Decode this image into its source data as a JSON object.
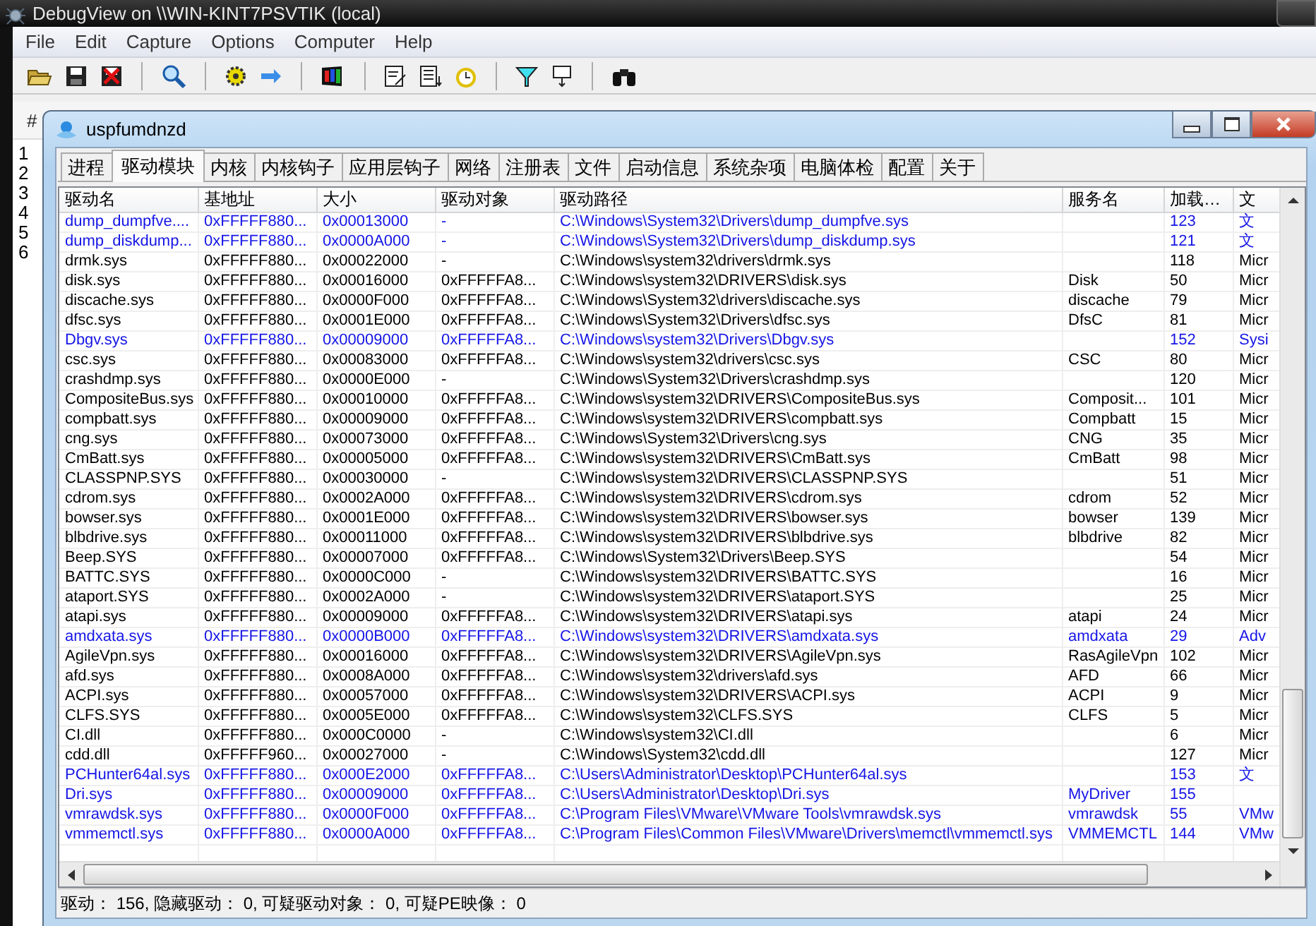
{
  "background_window": {
    "title": "DebugView on \\\\WIN-KINT7PSVTIK (local)",
    "menu": [
      "File",
      "Edit",
      "Capture",
      "Options",
      "Computer",
      "Help"
    ],
    "list": {
      "columns": [
        "#"
      ],
      "rows": [
        "1",
        "2",
        "3",
        "4",
        "5",
        "6"
      ]
    }
  },
  "window": {
    "title": "uspfumdnzd"
  },
  "tabs": [
    {
      "label": "进程",
      "selected": false
    },
    {
      "label": "驱动模块",
      "selected": true
    },
    {
      "label": "内核",
      "selected": false
    },
    {
      "label": "内核钩子",
      "selected": false
    },
    {
      "label": "应用层钩子",
      "selected": false
    },
    {
      "label": "网络",
      "selected": false
    },
    {
      "label": "注册表",
      "selected": false
    },
    {
      "label": "文件",
      "selected": false
    },
    {
      "label": "启动信息",
      "selected": false
    },
    {
      "label": "系统杂项",
      "selected": false
    },
    {
      "label": "电脑体检",
      "selected": false
    },
    {
      "label": "配置",
      "selected": false
    },
    {
      "label": "关于",
      "selected": false
    }
  ],
  "table": {
    "columns": [
      "驱动名",
      "基地址",
      "大小",
      "驱动对象",
      "驱动路径",
      "服务名",
      "加载…",
      "文"
    ],
    "rows": [
      {
        "highlighted": true,
        "cells": [
          "dump_dumpfve....",
          "0xFFFFF880...",
          "0x00013000",
          "-",
          "C:\\Windows\\System32\\Drivers\\dump_dumpfve.sys",
          "",
          "123",
          "文"
        ]
      },
      {
        "highlighted": true,
        "cells": [
          "dump_diskdump...",
          "0xFFFFF880...",
          "0x0000A000",
          "-",
          "C:\\Windows\\System32\\Drivers\\dump_diskdump.sys",
          "",
          "121",
          "文"
        ]
      },
      {
        "highlighted": false,
        "cells": [
          "drmk.sys",
          "0xFFFFF880...",
          "0x00022000",
          "-",
          "C:\\Windows\\system32\\drivers\\drmk.sys",
          "",
          "118",
          "Micr"
        ]
      },
      {
        "highlighted": false,
        "cells": [
          "disk.sys",
          "0xFFFFF880...",
          "0x00016000",
          "0xFFFFFA8...",
          "C:\\Windows\\system32\\DRIVERS\\disk.sys",
          "Disk",
          "50",
          "Micr"
        ]
      },
      {
        "highlighted": false,
        "cells": [
          "discache.sys",
          "0xFFFFF880...",
          "0x0000F000",
          "0xFFFFFA8...",
          "C:\\Windows\\System32\\drivers\\discache.sys",
          "discache",
          "79",
          "Micr"
        ]
      },
      {
        "highlighted": false,
        "cells": [
          "dfsc.sys",
          "0xFFFFF880...",
          "0x0001E000",
          "0xFFFFFA8...",
          "C:\\Windows\\System32\\Drivers\\dfsc.sys",
          "DfsC",
          "81",
          "Micr"
        ]
      },
      {
        "highlighted": true,
        "cells": [
          "Dbgv.sys",
          "0xFFFFF880...",
          "0x00009000",
          "0xFFFFFA8...",
          "C:\\Windows\\system32\\Drivers\\Dbgv.sys",
          "",
          "152",
          "Sysi"
        ]
      },
      {
        "highlighted": false,
        "cells": [
          "csc.sys",
          "0xFFFFF880...",
          "0x00083000",
          "0xFFFFFA8...",
          "C:\\Windows\\system32\\drivers\\csc.sys",
          "CSC",
          "80",
          "Micr"
        ]
      },
      {
        "highlighted": false,
        "cells": [
          "crashdmp.sys",
          "0xFFFFF880...",
          "0x0000E000",
          "-",
          "C:\\Windows\\System32\\Drivers\\crashdmp.sys",
          "",
          "120",
          "Micr"
        ]
      },
      {
        "highlighted": false,
        "cells": [
          "CompositeBus.sys",
          "0xFFFFF880...",
          "0x00010000",
          "0xFFFFFA8...",
          "C:\\Windows\\system32\\DRIVERS\\CompositeBus.sys",
          "Composit...",
          "101",
          "Micr"
        ]
      },
      {
        "highlighted": false,
        "cells": [
          "compbatt.sys",
          "0xFFFFF880...",
          "0x00009000",
          "0xFFFFFA8...",
          "C:\\Windows\\system32\\DRIVERS\\compbatt.sys",
          "Compbatt",
          "15",
          "Micr"
        ]
      },
      {
        "highlighted": false,
        "cells": [
          "cng.sys",
          "0xFFFFF880...",
          "0x00073000",
          "0xFFFFFA8...",
          "C:\\Windows\\System32\\Drivers\\cng.sys",
          "CNG",
          "35",
          "Micr"
        ]
      },
      {
        "highlighted": false,
        "cells": [
          "CmBatt.sys",
          "0xFFFFF880...",
          "0x00005000",
          "0xFFFFFA8...",
          "C:\\Windows\\system32\\DRIVERS\\CmBatt.sys",
          "CmBatt",
          "98",
          "Micr"
        ]
      },
      {
        "highlighted": false,
        "cells": [
          "CLASSPNP.SYS",
          "0xFFFFF880...",
          "0x00030000",
          "-",
          "C:\\Windows\\system32\\DRIVERS\\CLASSPNP.SYS",
          "",
          "51",
          "Micr"
        ]
      },
      {
        "highlighted": false,
        "cells": [
          "cdrom.sys",
          "0xFFFFF880...",
          "0x0002A000",
          "0xFFFFFA8...",
          "C:\\Windows\\system32\\DRIVERS\\cdrom.sys",
          "cdrom",
          "52",
          "Micr"
        ]
      },
      {
        "highlighted": false,
        "cells": [
          "bowser.sys",
          "0xFFFFF880...",
          "0x0001E000",
          "0xFFFFFA8...",
          "C:\\Windows\\system32\\DRIVERS\\bowser.sys",
          "bowser",
          "139",
          "Micr"
        ]
      },
      {
        "highlighted": false,
        "cells": [
          "blbdrive.sys",
          "0xFFFFF880...",
          "0x00011000",
          "0xFFFFFA8...",
          "C:\\Windows\\system32\\DRIVERS\\blbdrive.sys",
          "blbdrive",
          "82",
          "Micr"
        ]
      },
      {
        "highlighted": false,
        "cells": [
          "Beep.SYS",
          "0xFFFFF880...",
          "0x00007000",
          "0xFFFFFA8...",
          "C:\\Windows\\System32\\Drivers\\Beep.SYS",
          "",
          "54",
          "Micr"
        ]
      },
      {
        "highlighted": false,
        "cells": [
          "BATTC.SYS",
          "0xFFFFF880...",
          "0x0000C000",
          "-",
          "C:\\Windows\\system32\\DRIVERS\\BATTC.SYS",
          "",
          "16",
          "Micr"
        ]
      },
      {
        "highlighted": false,
        "cells": [
          "ataport.SYS",
          "0xFFFFF880...",
          "0x0002A000",
          "-",
          "C:\\Windows\\system32\\DRIVERS\\ataport.SYS",
          "",
          "25",
          "Micr"
        ]
      },
      {
        "highlighted": false,
        "cells": [
          "atapi.sys",
          "0xFFFFF880...",
          "0x00009000",
          "0xFFFFFA8...",
          "C:\\Windows\\system32\\DRIVERS\\atapi.sys",
          "atapi",
          "24",
          "Micr"
        ]
      },
      {
        "highlighted": true,
        "cells": [
          "amdxata.sys",
          "0xFFFFF880...",
          "0x0000B000",
          "0xFFFFFA8...",
          "C:\\Windows\\system32\\DRIVERS\\amdxata.sys",
          "amdxata",
          "29",
          "Adv"
        ]
      },
      {
        "highlighted": false,
        "cells": [
          "AgileVpn.sys",
          "0xFFFFF880...",
          "0x00016000",
          "0xFFFFFA8...",
          "C:\\Windows\\system32\\DRIVERS\\AgileVpn.sys",
          "RasAgileVpn",
          "102",
          "Micr"
        ]
      },
      {
        "highlighted": false,
        "cells": [
          "afd.sys",
          "0xFFFFF880...",
          "0x0008A000",
          "0xFFFFFA8...",
          "C:\\Windows\\system32\\drivers\\afd.sys",
          "AFD",
          "66",
          "Micr"
        ]
      },
      {
        "highlighted": false,
        "cells": [
          "ACPI.sys",
          "0xFFFFF880...",
          "0x00057000",
          "0xFFFFFA8...",
          "C:\\Windows\\system32\\DRIVERS\\ACPI.sys",
          "ACPI",
          "9",
          "Micr"
        ]
      },
      {
        "highlighted": false,
        "cells": [
          "CLFS.SYS",
          "0xFFFFF880...",
          "0x0005E000",
          "0xFFFFFA8...",
          "C:\\Windows\\system32\\CLFS.SYS",
          "CLFS",
          "5",
          "Micr"
        ]
      },
      {
        "highlighted": false,
        "cells": [
          "CI.dll",
          "0xFFFFF880...",
          "0x000C0000",
          "-",
          "C:\\Windows\\system32\\CI.dll",
          "",
          "6",
          "Micr"
        ]
      },
      {
        "highlighted": false,
        "cells": [
          "cdd.dll",
          "0xFFFFF960...",
          "0x00027000",
          "-",
          "C:\\Windows\\System32\\cdd.dll",
          "",
          "127",
          "Micr"
        ]
      },
      {
        "highlighted": true,
        "cells": [
          "PCHunter64al.sys",
          "0xFFFFF880...",
          "0x000E2000",
          "0xFFFFFA8...",
          "C:\\Users\\Administrator\\Desktop\\PCHunter64al.sys",
          "",
          "153",
          "文"
        ]
      },
      {
        "highlighted": true,
        "cells": [
          "Dri.sys",
          "0xFFFFF880...",
          "0x00009000",
          "0xFFFFFA8...",
          "C:\\Users\\Administrator\\Desktop\\Dri.sys",
          "MyDriver",
          "155",
          ""
        ]
      },
      {
        "highlighted": true,
        "cells": [
          "vmrawdsk.sys",
          "0xFFFFF880...",
          "0x0000F000",
          "0xFFFFFA8...",
          "C:\\Program Files\\VMware\\VMware Tools\\vmrawdsk.sys",
          "vmrawdsk",
          "55",
          "VMw"
        ]
      },
      {
        "highlighted": true,
        "cells": [
          "vmmemctl.sys",
          "0xFFFFF880...",
          "0x0000A000",
          "0xFFFFFA8...",
          "C:\\Program Files\\Common Files\\VMware\\Drivers\\memctl\\vmmemctl.sys",
          "VMMEMCTL",
          "144",
          "VMw"
        ]
      }
    ]
  },
  "status_bar": "驱动： 156, 隐藏驱动： 0, 可疑驱动对象： 0, 可疑PE映像： 0"
}
